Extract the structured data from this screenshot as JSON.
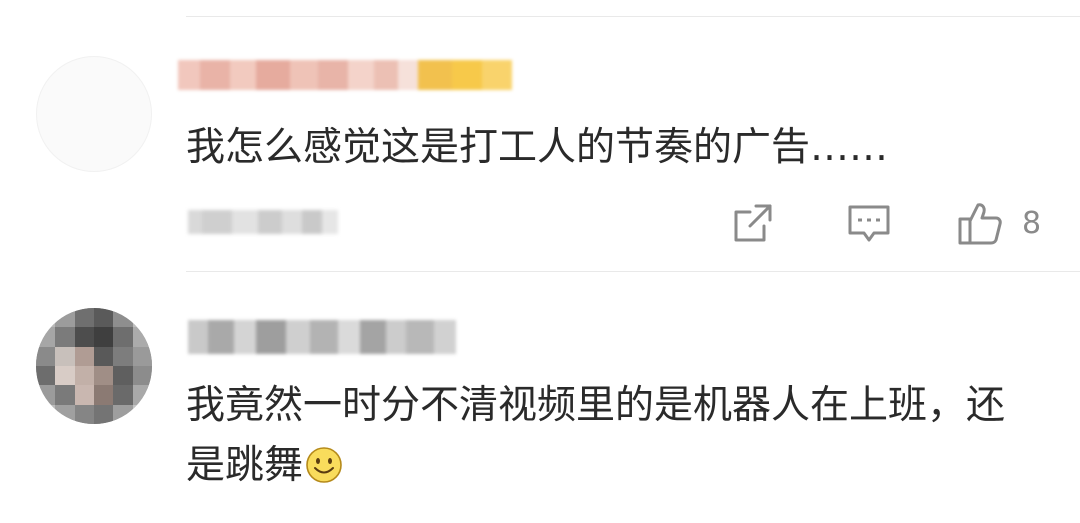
{
  "comments": [
    {
      "text": "我怎么感觉这是打工人的节奏的广告……",
      "like_count": "8"
    },
    {
      "text": "我竟然一时分不清视频里的是机器人在上班，还是跳舞"
    }
  ],
  "icons": {
    "share": "share-icon",
    "reply": "comment-icon",
    "like": "thumbs-up-icon",
    "emoji": "smile-emoji-icon"
  },
  "colors": {
    "text": "#2a2a2a",
    "icon": "#8a8a8a",
    "divider": "#e9e9e9",
    "emoji_fill": "#f9dc5c"
  }
}
